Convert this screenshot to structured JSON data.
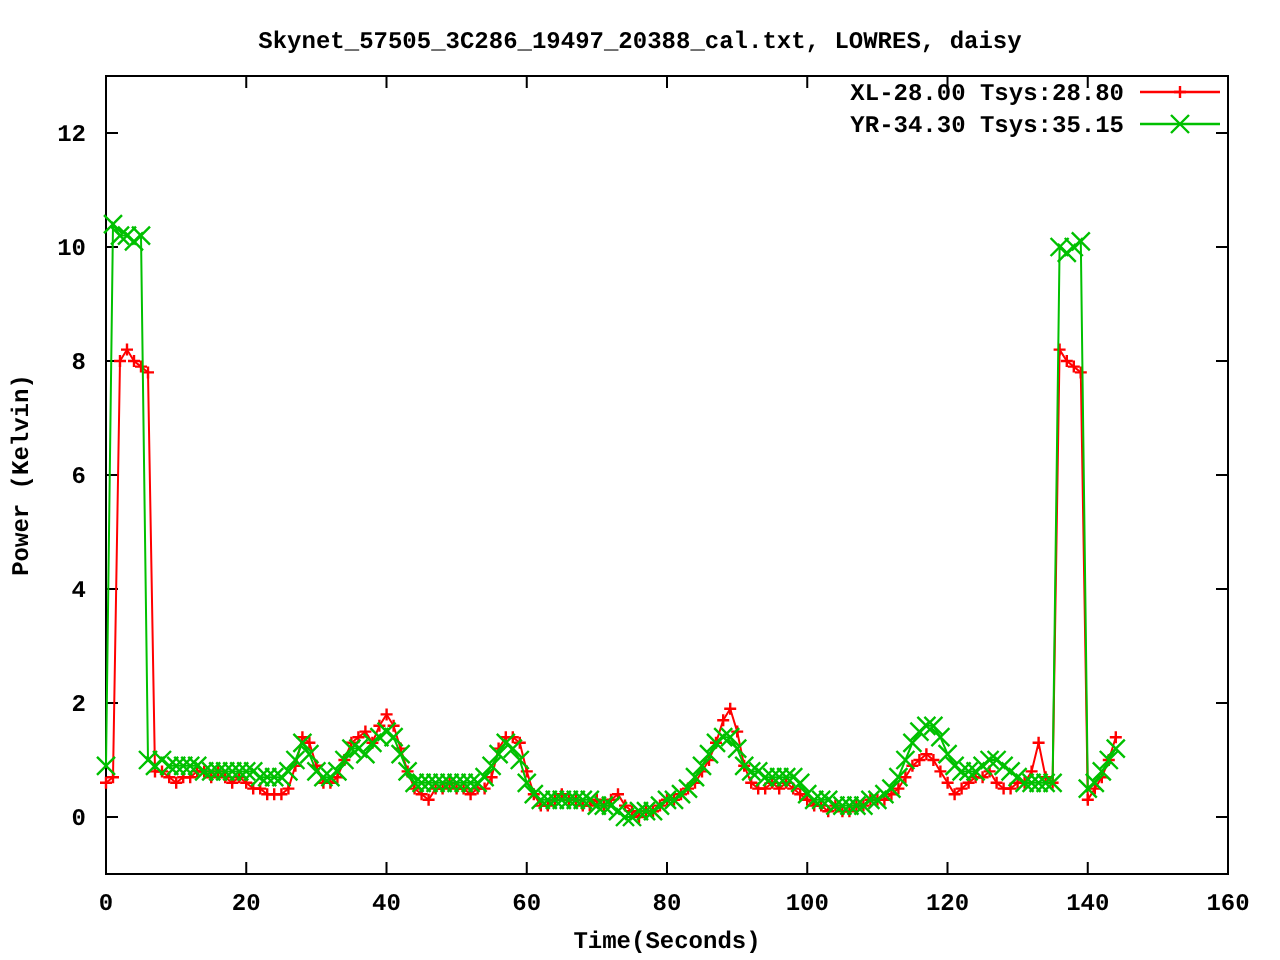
{
  "chart_data": {
    "type": "line",
    "title": "Skynet_57505_3C286_19497_20388_cal.txt, LOWRES, daisy",
    "xlabel": "Time(Seconds)",
    "ylabel": "Power (Kelvin)",
    "x": [
      0,
      1,
      2,
      3,
      4,
      5,
      6,
      7,
      8,
      9,
      10,
      11,
      12,
      13,
      14,
      15,
      16,
      17,
      18,
      19,
      20,
      21,
      22,
      23,
      24,
      25,
      26,
      27,
      28,
      29,
      30,
      31,
      32,
      33,
      34,
      35,
      36,
      37,
      38,
      39,
      40,
      41,
      42,
      43,
      44,
      45,
      46,
      47,
      48,
      49,
      50,
      51,
      52,
      53,
      54,
      55,
      56,
      57,
      58,
      59,
      60,
      61,
      62,
      63,
      64,
      65,
      66,
      67,
      68,
      69,
      70,
      71,
      72,
      73,
      74,
      75,
      76,
      77,
      78,
      79,
      80,
      81,
      82,
      83,
      84,
      85,
      86,
      87,
      88,
      89,
      90,
      91,
      92,
      93,
      94,
      95,
      96,
      97,
      98,
      99,
      100,
      101,
      102,
      103,
      104,
      105,
      106,
      107,
      108,
      109,
      110,
      111,
      112,
      113,
      114,
      115,
      116,
      117,
      118,
      119,
      120,
      121,
      122,
      123,
      124,
      125,
      126,
      127,
      128,
      129,
      130,
      131,
      132,
      133,
      134,
      135,
      136,
      137,
      138,
      139,
      140,
      141,
      142,
      143,
      144
    ],
    "series": [
      {
        "name": "XL-28.00 Tsys:28.80",
        "color": "#ff0000",
        "marker": "plus",
        "values": [
          0.6,
          0.7,
          8.0,
          8.2,
          8.0,
          7.9,
          7.8,
          0.8,
          0.8,
          0.7,
          0.6,
          0.7,
          0.7,
          0.8,
          0.8,
          0.7,
          0.8,
          0.7,
          0.6,
          0.7,
          0.6,
          0.5,
          0.5,
          0.4,
          0.4,
          0.4,
          0.5,
          0.9,
          1.4,
          1.3,
          0.9,
          0.6,
          0.6,
          0.7,
          1.0,
          1.3,
          1.4,
          1.5,
          1.3,
          1.6,
          1.8,
          1.6,
          1.2,
          0.8,
          0.5,
          0.4,
          0.3,
          0.5,
          0.5,
          0.6,
          0.5,
          0.5,
          0.4,
          0.5,
          0.5,
          0.7,
          1.2,
          1.4,
          1.4,
          1.3,
          0.8,
          0.4,
          0.2,
          0.2,
          0.3,
          0.4,
          0.3,
          0.3,
          0.2,
          0.2,
          0.3,
          0.2,
          0.3,
          0.4,
          0.2,
          0.1,
          0.0,
          0.1,
          0.1,
          0.2,
          0.3,
          0.3,
          0.4,
          0.5,
          0.6,
          0.8,
          1.0,
          1.3,
          1.7,
          1.9,
          1.5,
          0.9,
          0.6,
          0.5,
          0.5,
          0.6,
          0.5,
          0.6,
          0.5,
          0.4,
          0.3,
          0.2,
          0.2,
          0.1,
          0.2,
          0.1,
          0.1,
          0.2,
          0.2,
          0.3,
          0.3,
          0.3,
          0.4,
          0.5,
          0.7,
          0.9,
          1.0,
          1.1,
          1.0,
          0.8,
          0.6,
          0.4,
          0.5,
          0.6,
          0.7,
          0.7,
          0.8,
          0.6,
          0.5,
          0.5,
          0.6,
          0.6,
          0.8,
          1.3,
          0.7,
          0.6,
          8.2,
          8.0,
          7.9,
          7.8,
          0.3,
          0.5,
          0.7,
          1.0,
          1.4
        ]
      },
      {
        "name": "YR-34.30 Tsys:35.15",
        "color": "#00c000",
        "marker": "cross",
        "values": [
          0.9,
          10.4,
          10.2,
          10.2,
          10.1,
          10.2,
          1.0,
          0.9,
          1.0,
          0.9,
          0.9,
          0.9,
          0.9,
          0.9,
          0.8,
          0.8,
          0.8,
          0.8,
          0.8,
          0.8,
          0.8,
          0.8,
          0.7,
          0.7,
          0.7,
          0.7,
          0.8,
          1.0,
          1.3,
          1.1,
          0.8,
          0.7,
          0.7,
          0.8,
          1.0,
          1.2,
          1.2,
          1.1,
          1.3,
          1.4,
          1.5,
          1.4,
          1.1,
          0.8,
          0.6,
          0.6,
          0.6,
          0.6,
          0.6,
          0.6,
          0.6,
          0.6,
          0.6,
          0.6,
          0.7,
          0.9,
          1.1,
          1.3,
          1.2,
          1.0,
          0.6,
          0.4,
          0.3,
          0.3,
          0.3,
          0.3,
          0.3,
          0.3,
          0.3,
          0.3,
          0.2,
          0.2,
          0.2,
          0.1,
          0.0,
          0.0,
          0.1,
          0.1,
          0.1,
          0.2,
          0.3,
          0.3,
          0.4,
          0.5,
          0.7,
          0.9,
          1.1,
          1.3,
          1.4,
          1.4,
          1.2,
          0.9,
          0.8,
          0.8,
          0.7,
          0.7,
          0.7,
          0.7,
          0.7,
          0.6,
          0.4,
          0.3,
          0.3,
          0.3,
          0.2,
          0.2,
          0.2,
          0.2,
          0.2,
          0.3,
          0.3,
          0.4,
          0.5,
          0.7,
          1.0,
          1.3,
          1.5,
          1.6,
          1.6,
          1.4,
          1.1,
          0.9,
          0.8,
          0.8,
          0.8,
          0.9,
          1.0,
          1.0,
          0.9,
          0.8,
          0.7,
          0.6,
          0.6,
          0.6,
          0.6,
          0.6,
          10.0,
          9.9,
          10.0,
          10.1,
          0.5,
          0.6,
          0.8,
          1.0,
          1.2
        ]
      }
    ],
    "legend": true,
    "xlim": [
      0,
      160
    ],
    "ylim": [
      -1,
      13
    ],
    "xticks": [
      0,
      20,
      40,
      60,
      80,
      100,
      120,
      140,
      160
    ],
    "yticks": [
      0,
      2,
      4,
      6,
      8,
      10,
      12
    ]
  }
}
